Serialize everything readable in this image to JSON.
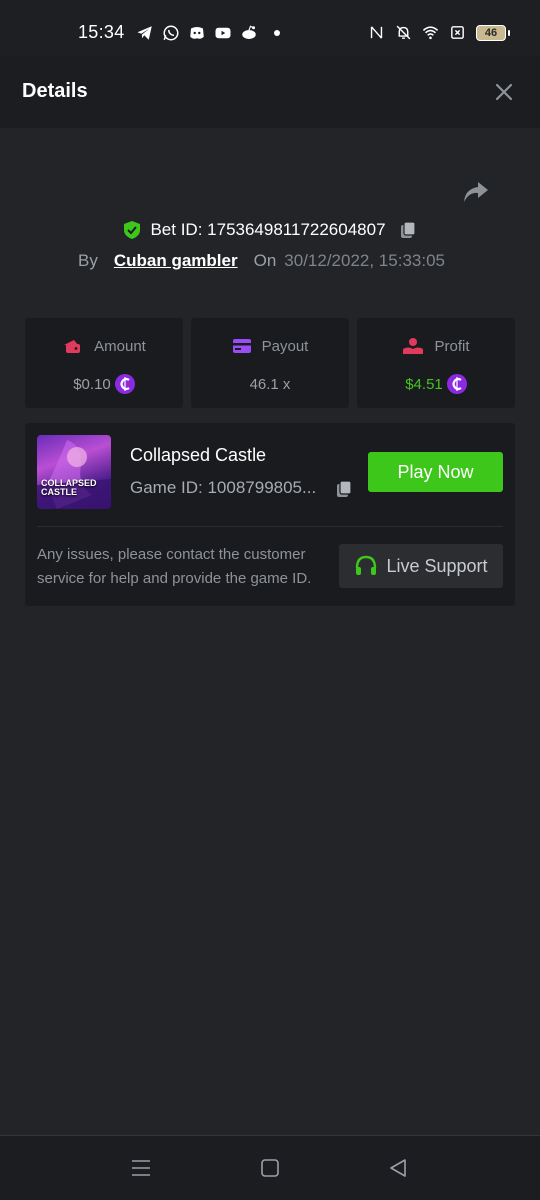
{
  "status_bar": {
    "time": "15:34",
    "battery": "46",
    "app_icons": [
      "telegram-icon",
      "whatsapp-icon",
      "discord-icon",
      "youtube-icon",
      "reddit-icon"
    ],
    "system_icons": [
      "nfc-icon",
      "mute-icon",
      "wifi-icon",
      "no-sim-icon"
    ]
  },
  "header": {
    "title": "Details",
    "close_icon": "close-icon"
  },
  "bet": {
    "id_text": "Bet ID: 1753649811722604807",
    "by_label": "By",
    "user": "Cuban gambler",
    "on_label": "On",
    "date": "30/12/2022, 15:33:05"
  },
  "stats": {
    "amount": {
      "label": "Amount",
      "value": "$0.10"
    },
    "payout": {
      "label": "Payout",
      "value": "46.1 x"
    },
    "profit": {
      "label": "Profit",
      "value": "$4.51"
    }
  },
  "game": {
    "name": "Collapsed Castle",
    "id_text": "Game ID: 1008799805...",
    "thumb_title_1": "COLLAPSED",
    "thumb_title_2": "CASTLE",
    "play_label": "Play Now"
  },
  "support": {
    "text": "Any issues, please contact the customer service for help and provide the game ID.",
    "button_label": "Live Support"
  },
  "colors": {
    "background": "#232427",
    "card": "#1a1b1e",
    "accent_green": "#3ec71b",
    "coin_purple": "#8a2be2"
  }
}
